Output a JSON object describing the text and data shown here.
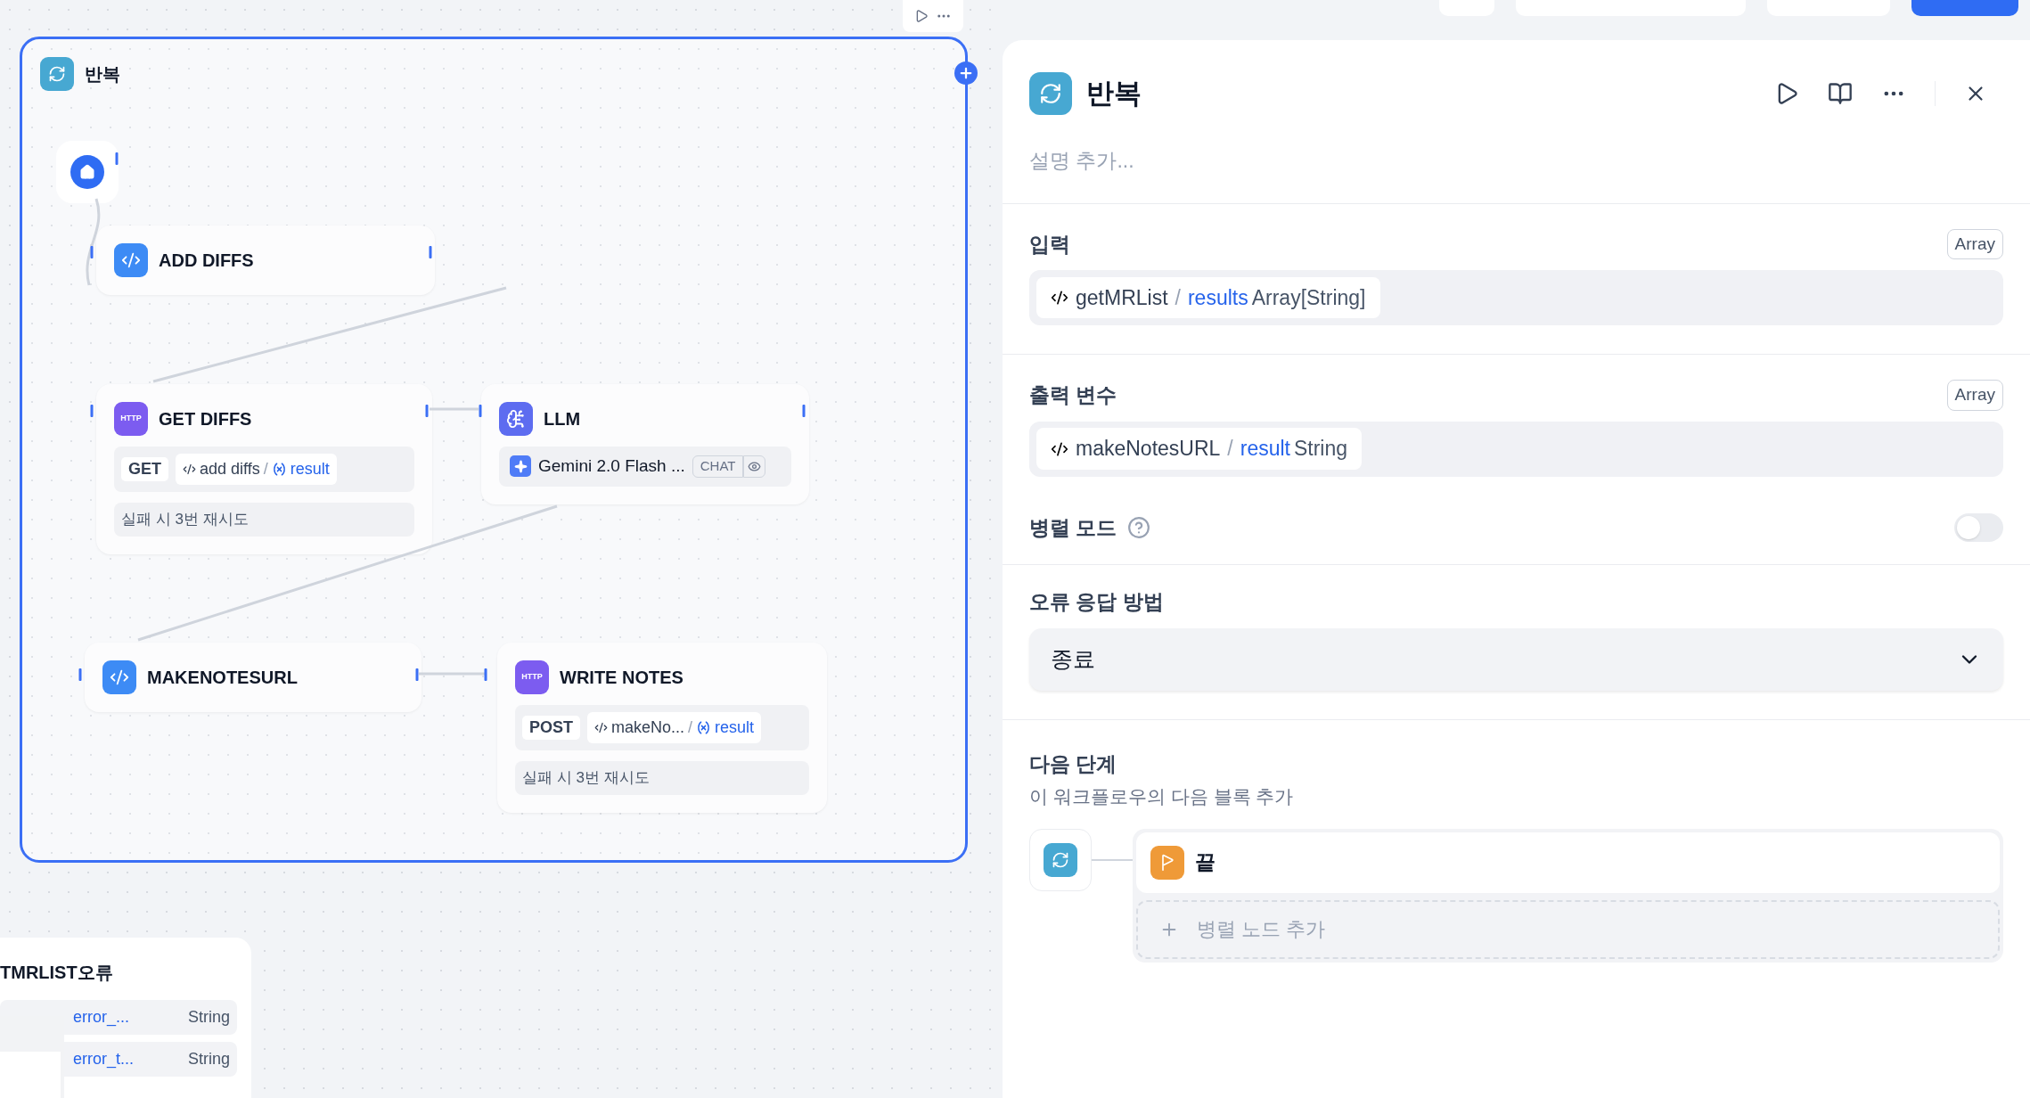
{
  "canvas": {
    "loop_title": "반복",
    "nodes": [
      {
        "kind": "code",
        "title": "ADD DIFFS"
      },
      {
        "kind": "http",
        "title": "GET DIFFS",
        "icon_label": "HTTP",
        "method": "GET",
        "source": "add diffs",
        "separator": "/",
        "variable": "result",
        "retry": "실패 시 3번 재시도"
      },
      {
        "kind": "llm",
        "title": "LLM",
        "model": "Gemini 2.0 Flash ...",
        "mode": "CHAT"
      },
      {
        "kind": "code",
        "title": "MAKENOTESURL"
      },
      {
        "kind": "http",
        "title": "WRITE NOTES",
        "icon_label": "HTTP",
        "method": "POST",
        "source": "makeNo...",
        "separator": "/",
        "variable": "result",
        "retry": "실패 시 3번 재시도"
      }
    ],
    "error_node": {
      "title": "TMRLIST오류",
      "outputs": [
        {
          "name": "error_...",
          "type": "String"
        },
        {
          "name": "error_t...",
          "type": "String"
        }
      ]
    }
  },
  "panel": {
    "title": "반복",
    "description_placeholder": "설명 추가...",
    "sections": [
      {
        "kind": "variable",
        "label": "입력",
        "type": "Array",
        "source": "getMRList",
        "separator": "/",
        "variable": "results",
        "var_type": "Array[String]"
      },
      {
        "kind": "variable",
        "label": "출력 변수",
        "type": "Array",
        "source": "makeNotesURL",
        "separator": "/",
        "variable": "result",
        "var_type": "String"
      },
      {
        "kind": "toggle",
        "label": "병렬 모드",
        "on": false
      },
      {
        "kind": "select",
        "label": "오류 응답 방법",
        "value": "종료"
      },
      {
        "kind": "next",
        "label": "다음 단계",
        "subtitle": "이 워크플로우의 다음 블록 추가",
        "next": "끝",
        "add_parallel": "병렬 노드 추가"
      }
    ]
  }
}
